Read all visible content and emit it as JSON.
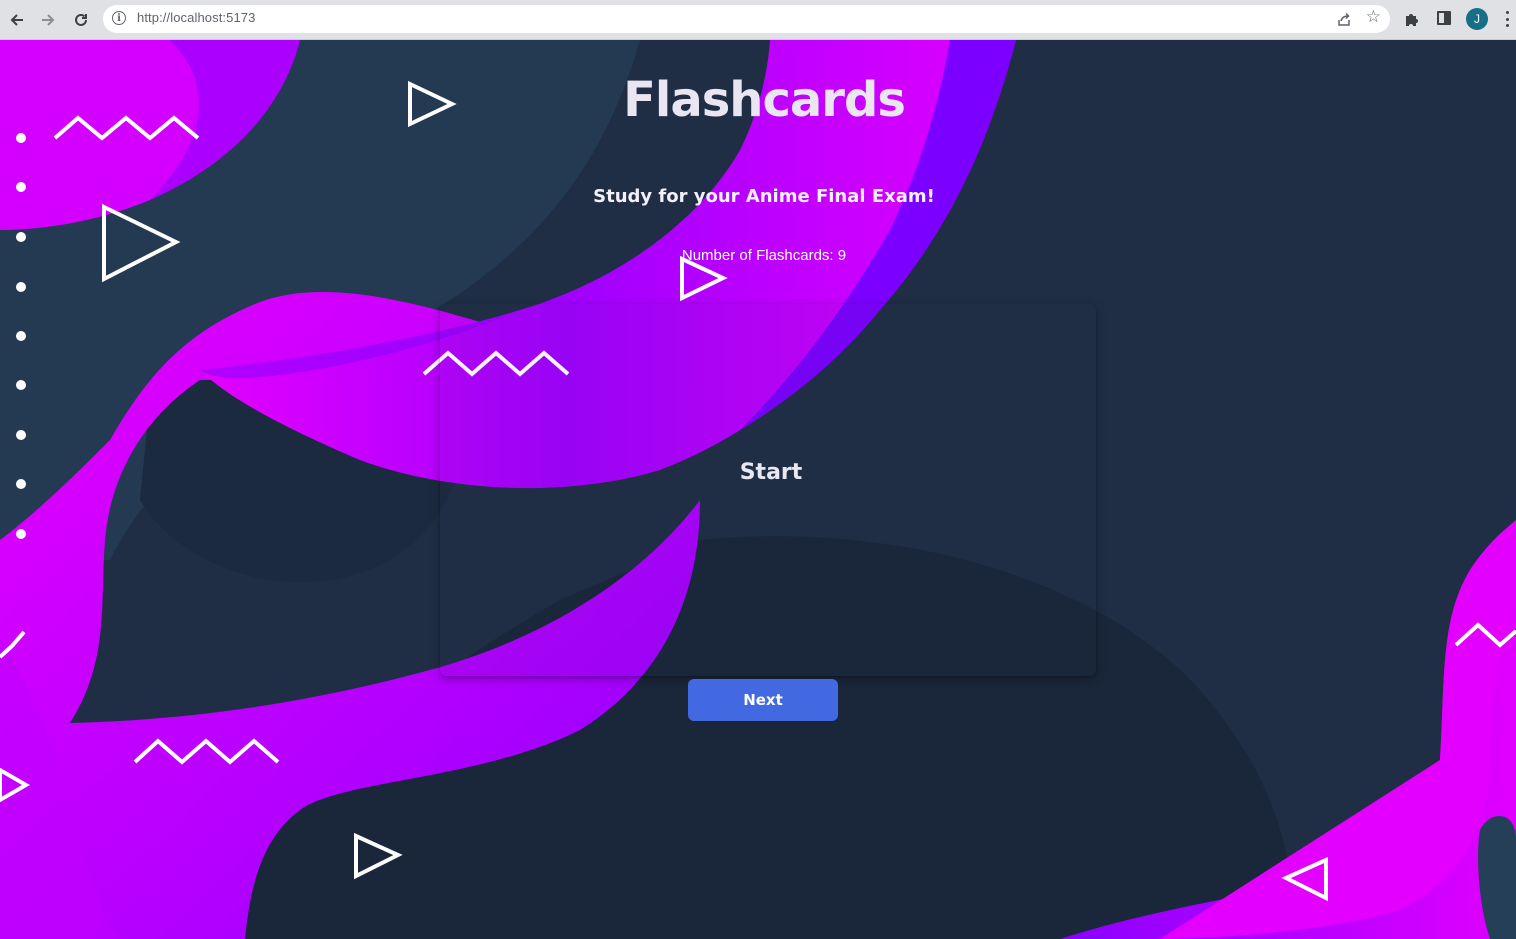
{
  "browser": {
    "url": "http://localhost:5173",
    "profile_initial": "J",
    "icons": {
      "back": "arrow-left-icon",
      "forward": "arrow-right-icon",
      "reload": "reload-icon",
      "site_info": "info-icon",
      "share": "share-icon",
      "bookmark": "star-icon",
      "extensions": "puzzle-icon",
      "side_panel": "side-panel-icon",
      "menu": "kebab-menu-icon"
    }
  },
  "page": {
    "title": "Flashcards",
    "subtitle": "Study for your Anime Final Exam!",
    "count_label": "Number of Flashcards:",
    "count_value": "9",
    "card_text": "Start",
    "next_label": "Next"
  },
  "colors": {
    "background": "#1f2e45",
    "wave_magenta": "#e100ff",
    "wave_violet": "#8a00ff",
    "button": "#4269e1",
    "decoration": "#ffffff"
  }
}
